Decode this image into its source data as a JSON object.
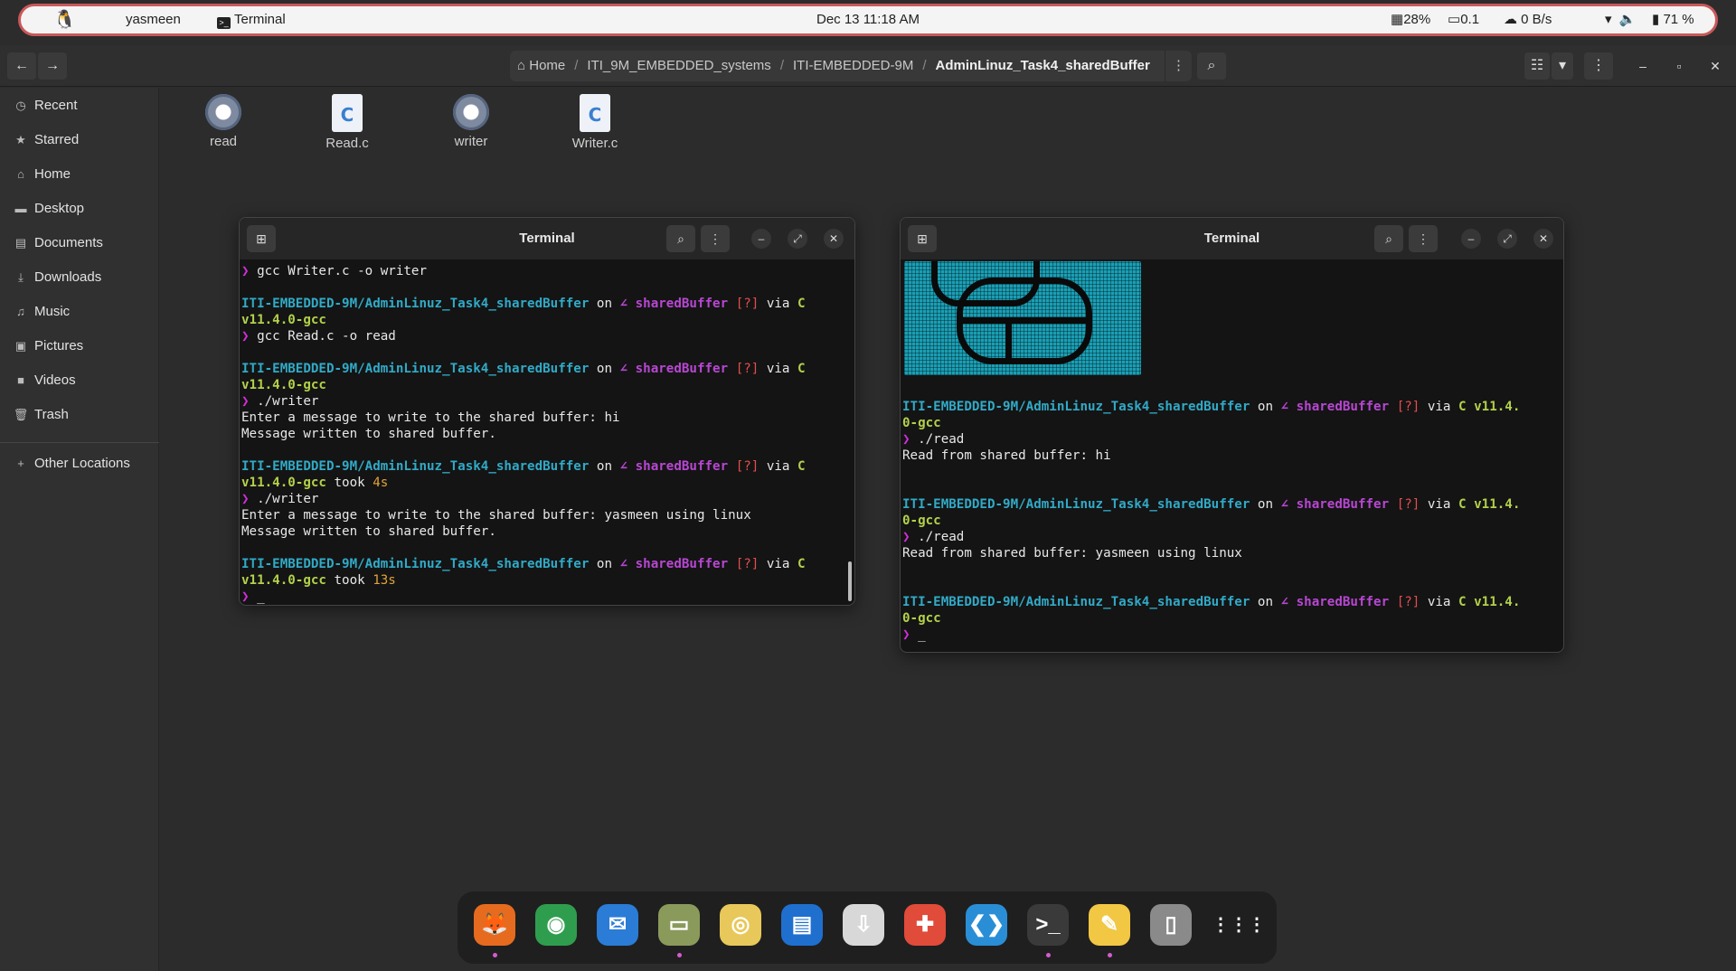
{
  "topbar": {
    "user": "yasmeen",
    "app_title": "Terminal",
    "clock": "Dec 13  11:18 AM",
    "cpu": "28%",
    "load": "0.1",
    "net": "0 B/s",
    "battery": "71 %"
  },
  "files_header": {
    "breadcrumb": [
      "Home",
      "ITI_9M_EMBEDDED_systems",
      "ITI-EMBEDDED-9M",
      "AdminLinuz_Task4_sharedBuffer"
    ]
  },
  "sidebar": {
    "items": [
      {
        "label": "Recent",
        "icon": "clock-icon"
      },
      {
        "label": "Starred",
        "icon": "star-icon"
      },
      {
        "label": "Home",
        "icon": "home-icon"
      },
      {
        "label": "Desktop",
        "icon": "desktop-icon"
      },
      {
        "label": "Documents",
        "icon": "document-icon"
      },
      {
        "label": "Downloads",
        "icon": "download-icon"
      },
      {
        "label": "Music",
        "icon": "music-icon"
      },
      {
        "label": "Pictures",
        "icon": "picture-icon"
      },
      {
        "label": "Videos",
        "icon": "video-icon"
      },
      {
        "label": "Trash",
        "icon": "trash-icon"
      }
    ],
    "other_locations": "Other Locations"
  },
  "files": [
    {
      "name": "read",
      "type": "executable"
    },
    {
      "name": "Read.c",
      "type": "c-source"
    },
    {
      "name": "writer",
      "type": "executable"
    },
    {
      "name": "Writer.c",
      "type": "c-source"
    }
  ],
  "terminal_left": {
    "title": "Terminal",
    "lines": [
      {
        "kind": "cmd",
        "text": "gcc Writer.c -o writer"
      },
      {
        "kind": "blank"
      },
      {
        "kind": "prompt",
        "path": "ITI-EMBEDDED-9M/AdminLinuz_Task4_sharedBuffer",
        "on": " on ",
        "branch": "∠ sharedBuffer",
        "status": "[?]",
        "via": " via ",
        "lang": "C"
      },
      {
        "kind": "lang",
        "text": "v11.4.0-gcc",
        "took": ""
      },
      {
        "kind": "cmd",
        "text": "gcc Read.c -o read"
      },
      {
        "kind": "blank"
      },
      {
        "kind": "prompt",
        "path": "ITI-EMBEDDED-9M/AdminLinuz_Task4_sharedBuffer",
        "on": " on ",
        "branch": "∠ sharedBuffer",
        "status": "[?]",
        "via": " via ",
        "lang": "C"
      },
      {
        "kind": "lang",
        "text": "v11.4.0-gcc",
        "took": ""
      },
      {
        "kind": "cmd",
        "text": "./writer"
      },
      {
        "kind": "out",
        "text": "Enter a message to write to the shared buffer: hi"
      },
      {
        "kind": "out",
        "text": "Message written to shared buffer."
      },
      {
        "kind": "blank"
      },
      {
        "kind": "prompt",
        "path": "ITI-EMBEDDED-9M/AdminLinuz_Task4_sharedBuffer",
        "on": " on ",
        "branch": "∠ sharedBuffer",
        "status": "[?]",
        "via": " via ",
        "lang": "C"
      },
      {
        "kind": "lang",
        "text": "v11.4.0-gcc",
        "took": "4s"
      },
      {
        "kind": "cmd",
        "text": "./writer"
      },
      {
        "kind": "out",
        "text": "Enter a message to write to the shared buffer: yasmeen using linux"
      },
      {
        "kind": "out",
        "text": "Message written to shared buffer."
      },
      {
        "kind": "blank"
      },
      {
        "kind": "prompt",
        "path": "ITI-EMBEDDED-9M/AdminLinuz_Task4_sharedBuffer",
        "on": " on ",
        "branch": "∠ sharedBuffer",
        "status": "[?]",
        "via": " via ",
        "lang": "C"
      },
      {
        "kind": "lang",
        "text": "v11.4.0-gcc",
        "took": "13s"
      },
      {
        "kind": "cursor",
        "text": "_"
      }
    ]
  },
  "terminal_right": {
    "title": "Terminal",
    "lines": [
      {
        "kind": "blank"
      },
      {
        "kind": "prompt",
        "path": "ITI-EMBEDDED-9M/AdminLinuz_Task4_sharedBuffer",
        "on": " on ",
        "branch": "∠ sharedBuffer",
        "status": "[?]",
        "via": " via ",
        "lang": "C v11.4."
      },
      {
        "kind": "lang",
        "text": "0-gcc",
        "took": ""
      },
      {
        "kind": "cmd",
        "text": "./read"
      },
      {
        "kind": "out",
        "text": "Read from shared buffer: hi"
      },
      {
        "kind": "blank"
      },
      {
        "kind": "blank"
      },
      {
        "kind": "prompt",
        "path": "ITI-EMBEDDED-9M/AdminLinuz_Task4_sharedBuffer",
        "on": " on ",
        "branch": "∠ sharedBuffer",
        "status": "[?]",
        "via": " via ",
        "lang": "C v11.4."
      },
      {
        "kind": "lang",
        "text": "0-gcc",
        "took": ""
      },
      {
        "kind": "cmd",
        "text": "./read"
      },
      {
        "kind": "out",
        "text": "Read from shared buffer: yasmeen using linux"
      },
      {
        "kind": "blank"
      },
      {
        "kind": "blank"
      },
      {
        "kind": "prompt",
        "path": "ITI-EMBEDDED-9M/AdminLinuz_Task4_sharedBuffer",
        "on": " on ",
        "branch": "∠ sharedBuffer",
        "status": "[?]",
        "via": " via ",
        "lang": "C v11.4."
      },
      {
        "kind": "lang",
        "text": "0-gcc",
        "took": ""
      },
      {
        "kind": "cursor",
        "text": "_"
      }
    ]
  },
  "dock": [
    {
      "name": "firefox",
      "color": "#e66b1f",
      "running": true
    },
    {
      "name": "chrome",
      "color": "#2f9d4e",
      "running": false
    },
    {
      "name": "thunderbird",
      "color": "#2a7cd6",
      "running": false
    },
    {
      "name": "files",
      "color": "#8a9a5b",
      "running": true
    },
    {
      "name": "rhythmbox",
      "color": "#e8c85a",
      "running": false
    },
    {
      "name": "writer",
      "color": "#1f6fcf",
      "running": false
    },
    {
      "name": "software",
      "color": "#d8d8d8",
      "running": false
    },
    {
      "name": "help",
      "color": "#e04b3a",
      "running": false
    },
    {
      "name": "vscode",
      "color": "#2a8ed6",
      "running": false
    },
    {
      "name": "terminal",
      "color": "#3a3a3a",
      "running": true
    },
    {
      "name": "text-editor",
      "color": "#f2c744",
      "running": true
    },
    {
      "name": "trash",
      "color": "#8a8a8a",
      "running": false
    },
    {
      "name": "app-grid",
      "color": "#1f1f1f",
      "running": false
    }
  ]
}
